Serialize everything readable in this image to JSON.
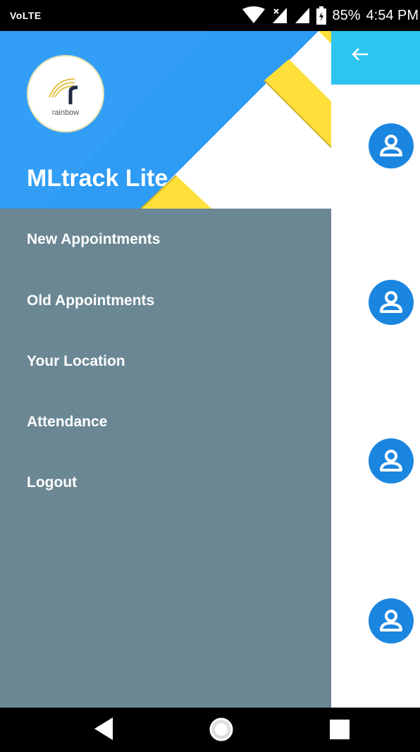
{
  "status_bar": {
    "carrier": "VoLTE",
    "battery": "85%",
    "time": "4:54 PM",
    "icons": [
      "wifi-icon",
      "no-signal-icon",
      "signal-icon",
      "battery-icon"
    ]
  },
  "drawer": {
    "logo_text": "rainbow",
    "app_title": "MLtrack Lite",
    "menu_items": [
      {
        "label": "New Appointments"
      },
      {
        "label": "Old Appointments"
      },
      {
        "label": "Your Location"
      },
      {
        "label": "Attendance"
      },
      {
        "label": "Logout"
      }
    ]
  },
  "appbar": {
    "back_icon": "arrow-left-icon"
  },
  "list": {
    "avatar_icon": "person-icon",
    "count": 4
  },
  "nav_bar": {
    "icons": [
      "back-triangle-icon",
      "home-circle-icon",
      "recents-square-icon"
    ]
  },
  "colors": {
    "drawer_bg": "#6b8794",
    "header_blue": "#2e9bf5",
    "header_yellow": "#ffe03a",
    "appbar": "#2ec4f0",
    "avatar_blue": "#1b86e0"
  }
}
